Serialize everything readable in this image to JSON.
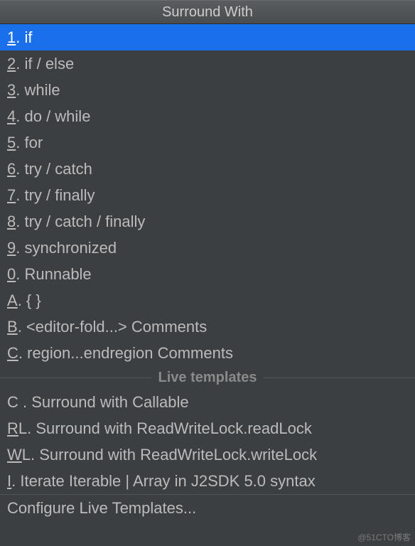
{
  "title": "Surround With",
  "items": [
    {
      "mnemonic": "1",
      "prefix": ". ",
      "label": "if",
      "selected": true
    },
    {
      "mnemonic": "2",
      "prefix": ". ",
      "label": "if / else"
    },
    {
      "mnemonic": "3",
      "prefix": ". ",
      "label": "while"
    },
    {
      "mnemonic": "4",
      "prefix": ". ",
      "label": "do / while"
    },
    {
      "mnemonic": "5",
      "prefix": ". ",
      "label": "for"
    },
    {
      "mnemonic": "6",
      "prefix": ". ",
      "label": "try / catch"
    },
    {
      "mnemonic": "7",
      "prefix": ". ",
      "label": "try / finally"
    },
    {
      "mnemonic": "8",
      "prefix": ". ",
      "label": "try / catch / finally"
    },
    {
      "mnemonic": "9",
      "prefix": ". ",
      "label": "synchronized"
    },
    {
      "mnemonic": "0",
      "prefix": ". ",
      "label": "Runnable"
    },
    {
      "mnemonic": "A",
      "prefix": ". ",
      "label": "{ }"
    },
    {
      "mnemonic": "B",
      "prefix": ". ",
      "label": "<editor-fold...> Comments"
    },
    {
      "mnemonic": "C",
      "prefix": ". ",
      "label": "region...endregion Comments"
    }
  ],
  "separator": "Live templates",
  "liveTemplates": [
    {
      "mnemonic": "",
      "prefix": "C . ",
      "label": "Surround with Callable"
    },
    {
      "mnemonic": "R",
      "prefix": "L. ",
      "label": "Surround with ReadWriteLock.readLock"
    },
    {
      "mnemonic": "W",
      "prefix": "L. ",
      "label": "Surround with ReadWriteLock.writeLock"
    },
    {
      "mnemonic": "I",
      "prefix": ". ",
      "label": "Iterate Iterable | Array in J2SDK 5.0 syntax"
    }
  ],
  "footer": "Configure Live Templates...",
  "watermark": "@51CTO博客"
}
